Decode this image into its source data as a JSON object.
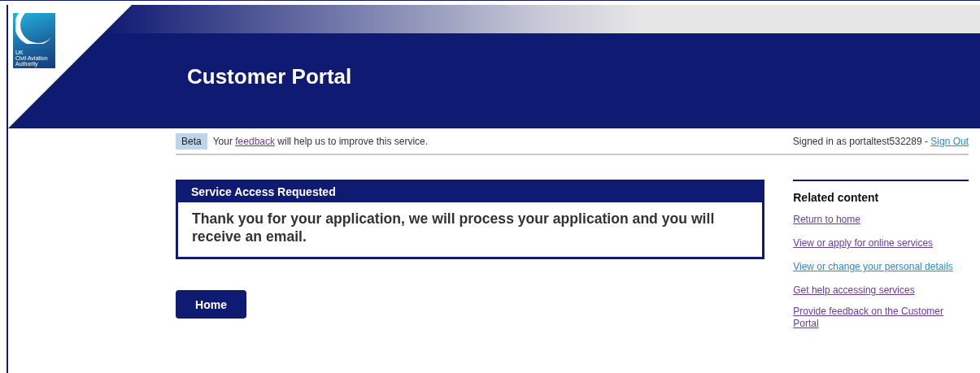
{
  "logo": {
    "lines": [
      "UK",
      "Civil Aviation",
      "Authority"
    ]
  },
  "header": {
    "title": "Customer Portal"
  },
  "beta_bar": {
    "badge": "Beta",
    "message_before": "Your",
    "feedback_link": "feedback",
    "message_after": "will help us to improve this service.",
    "signed_in": "Signed in as portaltest532289 -",
    "sign_out": "Sign Out"
  },
  "panel": {
    "heading": "Service Access Requested",
    "message": "Thank you for your application, we will process your application and you will receive an email."
  },
  "home_button": "Home",
  "related": {
    "heading": "Related content",
    "links": [
      {
        "label": "Return to home",
        "visited": true
      },
      {
        "label": "View or apply for online services",
        "visited": true
      },
      {
        "label": "View or change your personal details",
        "visited": false
      },
      {
        "label": "Get help accessing services",
        "visited": true
      },
      {
        "label": "Provide feedback on the Customer Portal",
        "visited": true
      }
    ]
  }
}
